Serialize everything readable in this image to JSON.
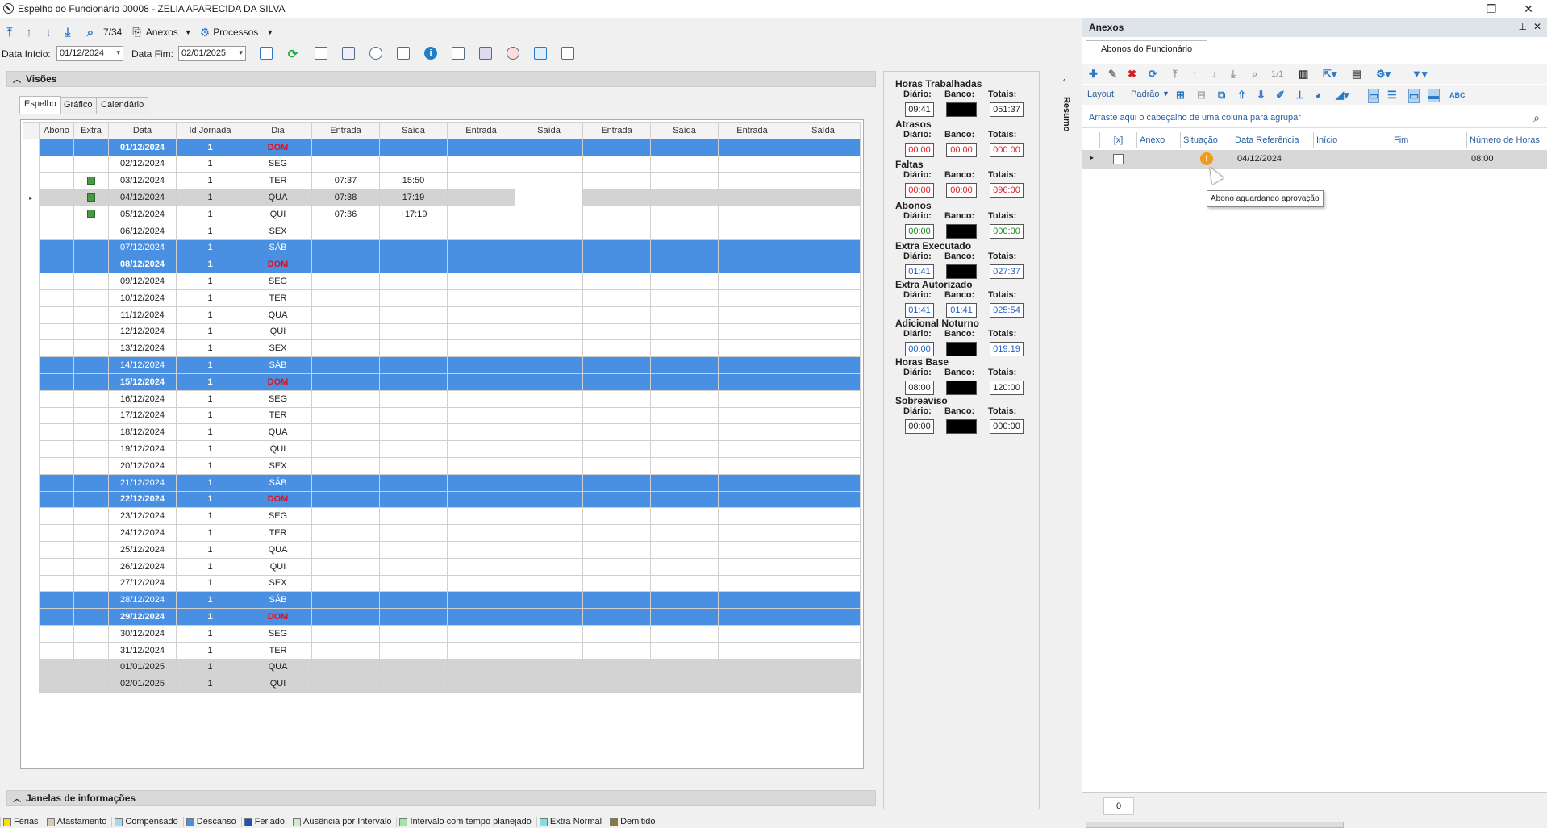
{
  "window": {
    "title": "Espelho do Funcionário 00008 - ZELIA APARECIDA DA SILVA",
    "minimize": "—",
    "restore": "❐",
    "close": "✕"
  },
  "toolbar": {
    "counter": "7/34",
    "anexos": "Anexos",
    "processos": "Processos"
  },
  "dates": {
    "inicio_label": "Data Início:",
    "inicio": "01/12/2024",
    "fim_label": "Data Fim:",
    "fim": "02/01/2025"
  },
  "visoes": {
    "title": "Visões",
    "tabs": [
      "Espelho",
      "Gráfico",
      "Calendário"
    ]
  },
  "janelas": {
    "title": "Janelas de informações"
  },
  "grid": {
    "columns": [
      "Abono",
      "Extra",
      "Data",
      "Id Jornada",
      "Dia",
      "Entrada",
      "Saída",
      "Entrada",
      "Saída",
      "Entrada",
      "Saída",
      "Entrada",
      "Saída"
    ],
    "rows": [
      {
        "extra": false,
        "data": "01/12/2024",
        "jornada": "1",
        "dia": "DOM",
        "e1": "",
        "s1": "",
        "type": "dom"
      },
      {
        "extra": false,
        "data": "02/12/2024",
        "jornada": "1",
        "dia": "SEG",
        "e1": "",
        "s1": "",
        "type": "normal"
      },
      {
        "extra": true,
        "data": "03/12/2024",
        "jornada": "1",
        "dia": "TER",
        "e1": "07:37",
        "s1": "15:50",
        "type": "normal"
      },
      {
        "extra": true,
        "data": "04/12/2024",
        "jornada": "1",
        "dia": "QUA",
        "e1": "07:38",
        "s1": "17:19",
        "type": "current"
      },
      {
        "extra": true,
        "data": "05/12/2024",
        "jornada": "1",
        "dia": "QUI",
        "e1": "07:36",
        "s1": "+17:19",
        "type": "normal"
      },
      {
        "extra": false,
        "data": "06/12/2024",
        "jornada": "1",
        "dia": "SEX",
        "e1": "",
        "s1": "",
        "type": "normal"
      },
      {
        "extra": false,
        "data": "07/12/2024",
        "jornada": "1",
        "dia": "SÁB",
        "e1": "",
        "s1": "",
        "type": "sab"
      },
      {
        "extra": false,
        "data": "08/12/2024",
        "jornada": "1",
        "dia": "DOM",
        "e1": "",
        "s1": "",
        "type": "dom"
      },
      {
        "extra": false,
        "data": "09/12/2024",
        "jornada": "1",
        "dia": "SEG",
        "e1": "",
        "s1": "",
        "type": "normal"
      },
      {
        "extra": false,
        "data": "10/12/2024",
        "jornada": "1",
        "dia": "TER",
        "e1": "",
        "s1": "",
        "type": "normal"
      },
      {
        "extra": false,
        "data": "11/12/2024",
        "jornada": "1",
        "dia": "QUA",
        "e1": "",
        "s1": "",
        "type": "normal"
      },
      {
        "extra": false,
        "data": "12/12/2024",
        "jornada": "1",
        "dia": "QUI",
        "e1": "",
        "s1": "",
        "type": "normal"
      },
      {
        "extra": false,
        "data": "13/12/2024",
        "jornada": "1",
        "dia": "SEX",
        "e1": "",
        "s1": "",
        "type": "normal"
      },
      {
        "extra": false,
        "data": "14/12/2024",
        "jornada": "1",
        "dia": "SÁB",
        "e1": "",
        "s1": "",
        "type": "sab"
      },
      {
        "extra": false,
        "data": "15/12/2024",
        "jornada": "1",
        "dia": "DOM",
        "e1": "",
        "s1": "",
        "type": "dom"
      },
      {
        "extra": false,
        "data": "16/12/2024",
        "jornada": "1",
        "dia": "SEG",
        "e1": "",
        "s1": "",
        "type": "normal"
      },
      {
        "extra": false,
        "data": "17/12/2024",
        "jornada": "1",
        "dia": "TER",
        "e1": "",
        "s1": "",
        "type": "normal"
      },
      {
        "extra": false,
        "data": "18/12/2024",
        "jornada": "1",
        "dia": "QUA",
        "e1": "",
        "s1": "",
        "type": "normal"
      },
      {
        "extra": false,
        "data": "19/12/2024",
        "jornada": "1",
        "dia": "QUI",
        "e1": "",
        "s1": "",
        "type": "normal"
      },
      {
        "extra": false,
        "data": "20/12/2024",
        "jornada": "1",
        "dia": "SEX",
        "e1": "",
        "s1": "",
        "type": "normal"
      },
      {
        "extra": false,
        "data": "21/12/2024",
        "jornada": "1",
        "dia": "SÁB",
        "e1": "",
        "s1": "",
        "type": "sab"
      },
      {
        "extra": false,
        "data": "22/12/2024",
        "jornada": "1",
        "dia": "DOM",
        "e1": "",
        "s1": "",
        "type": "dom"
      },
      {
        "extra": false,
        "data": "23/12/2024",
        "jornada": "1",
        "dia": "SEG",
        "e1": "",
        "s1": "",
        "type": "normal"
      },
      {
        "extra": false,
        "data": "24/12/2024",
        "jornada": "1",
        "dia": "TER",
        "e1": "",
        "s1": "",
        "type": "normal"
      },
      {
        "extra": false,
        "data": "25/12/2024",
        "jornada": "1",
        "dia": "QUA",
        "e1": "",
        "s1": "",
        "type": "normal"
      },
      {
        "extra": false,
        "data": "26/12/2024",
        "jornada": "1",
        "dia": "QUI",
        "e1": "",
        "s1": "",
        "type": "normal"
      },
      {
        "extra": false,
        "data": "27/12/2024",
        "jornada": "1",
        "dia": "SEX",
        "e1": "",
        "s1": "",
        "type": "normal"
      },
      {
        "extra": false,
        "data": "28/12/2024",
        "jornada": "1",
        "dia": "SÁB",
        "e1": "",
        "s1": "",
        "type": "sab"
      },
      {
        "extra": false,
        "data": "29/12/2024",
        "jornada": "1",
        "dia": "DOM",
        "e1": "",
        "s1": "",
        "type": "dom"
      },
      {
        "extra": false,
        "data": "30/12/2024",
        "jornada": "1",
        "dia": "SEG",
        "e1": "",
        "s1": "",
        "type": "normal"
      },
      {
        "extra": false,
        "data": "31/12/2024",
        "jornada": "1",
        "dia": "TER",
        "e1": "",
        "s1": "",
        "type": "normal"
      },
      {
        "extra": false,
        "data": "01/01/2025",
        "jornada": "1",
        "dia": "QUA",
        "e1": "",
        "s1": "",
        "type": "gray"
      },
      {
        "extra": false,
        "data": "02/01/2025",
        "jornada": "1",
        "dia": "QUI",
        "e1": "",
        "s1": "",
        "type": "gray"
      }
    ]
  },
  "resumo": {
    "side_label": "Resumo",
    "labels": {
      "diario": "Diário:",
      "banco": "Banco:",
      "totais": "Totais:"
    },
    "blocks": [
      {
        "title": "Horas Trabalhadas",
        "diario": "09:41",
        "banco": "",
        "totais": "051:37",
        "color": "black",
        "banco_black": true
      },
      {
        "title": "Atrasos",
        "diario": "00:00",
        "banco": "00:00",
        "totais": "000:00",
        "color": "red",
        "banco_black": false
      },
      {
        "title": "Faltas",
        "diario": "00:00",
        "banco": "00:00",
        "totais": "096:00",
        "color": "red",
        "banco_black": false
      },
      {
        "title": "Abonos",
        "diario": "00:00",
        "banco": "",
        "totais": "000:00",
        "color": "green",
        "banco_black": true
      },
      {
        "title": "Extra Executado",
        "diario": "01:41",
        "banco": "",
        "totais": "027:37",
        "color": "blue",
        "banco_black": true
      },
      {
        "title": "Extra Autorizado",
        "diario": "01:41",
        "banco": "01:41",
        "totais": "025:54",
        "color": "blue",
        "banco_black": false
      },
      {
        "title": "Adicional Noturno",
        "diario": "00:00",
        "banco": "",
        "totais": "019:19",
        "color": "blue",
        "banco_black": true
      },
      {
        "title": "Horas Base",
        "diario": "08:00",
        "banco": "",
        "totais": "120:00",
        "color": "black",
        "banco_black": true
      },
      {
        "title": "Sobreaviso",
        "diario": "00:00",
        "banco": "",
        "totais": "000:00",
        "color": "black",
        "banco_black": true
      }
    ]
  },
  "anexos": {
    "title": "Anexos",
    "tab": "Abonos do Funcionário",
    "pager": "1/1",
    "layout_label": "Layout:",
    "layout_value": "Padrão",
    "group_hint": "Arraste aqui o cabeçalho de uma coluna para agrupar",
    "columns": [
      "[x]",
      "Anexo",
      "Situação",
      "Data Referência",
      "Início",
      "Fim",
      "Número de Horas"
    ],
    "row": {
      "data_ref": "04/12/2024",
      "horas": "08:00"
    },
    "tooltip": "Abono aguardando aprovação",
    "footer_count": "0"
  },
  "legend": [
    {
      "label": "Férias",
      "color": "#f5e400"
    },
    {
      "label": "Afastamento",
      "color": "#d6cdb0"
    },
    {
      "label": "Compensado",
      "color": "#a8d8f0"
    },
    {
      "label": "Descanso",
      "color": "#4a90e2"
    },
    {
      "label": "Feriado",
      "color": "#1f4fbf"
    },
    {
      "label": "Ausência por Intervalo",
      "color": "#c8f0c8"
    },
    {
      "label": "Intervalo com tempo planejado",
      "color": "#a6e3a6"
    },
    {
      "label": "Extra Normal",
      "color": "#7fe0e0"
    },
    {
      "label": "Demitido",
      "color": "#8a7a3a"
    }
  ],
  "colors": {
    "accent": "#2b78c5",
    "weekend_row": "#4a90e2",
    "dom_text": "#e4101b",
    "warning": "#f29a1a"
  }
}
